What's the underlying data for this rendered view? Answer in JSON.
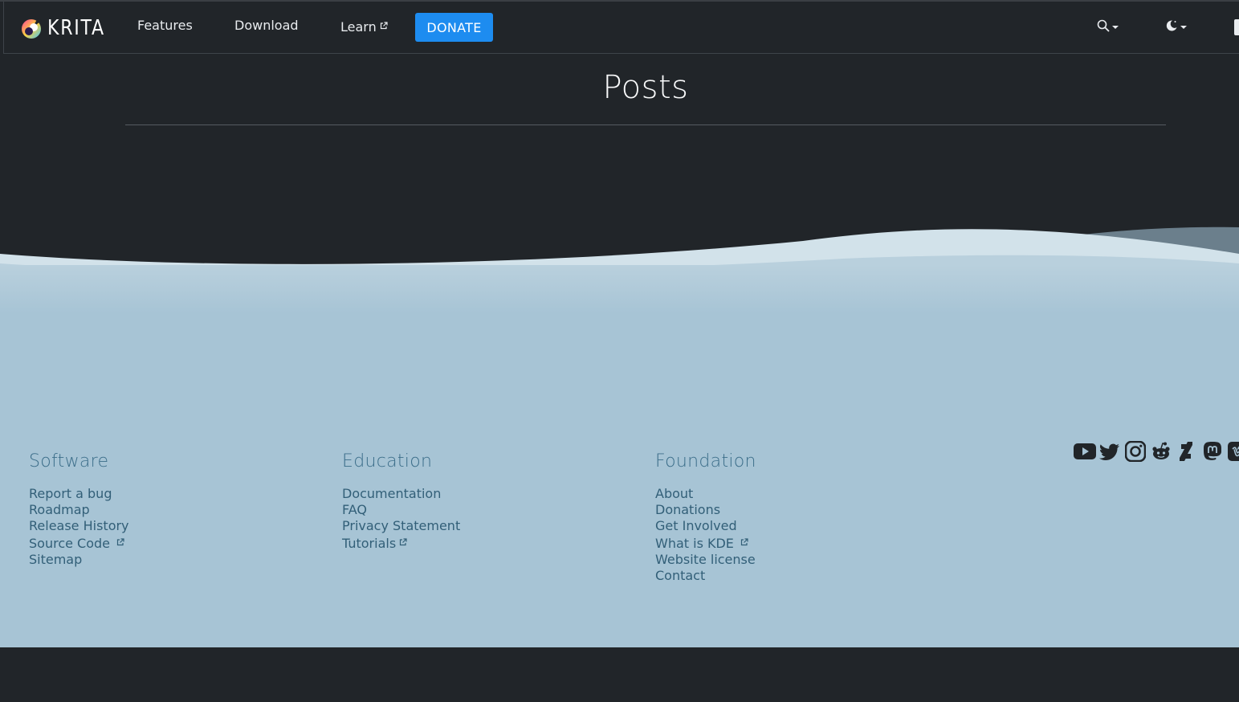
{
  "nav": {
    "brand": "KRITA",
    "links": {
      "features": "Features",
      "download": "Download",
      "learn": "Learn"
    },
    "donate": "DONATE",
    "icons": [
      "krita-logo-icon",
      "external-link-icon",
      "search-icon",
      "moon-icon",
      "chevron-down-icon"
    ]
  },
  "page": {
    "title": "Posts"
  },
  "footer": {
    "software": {
      "title": "Software",
      "items": [
        "Report a bug",
        "Roadmap",
        "Release History",
        "Source Code",
        "Sitemap"
      ]
    },
    "education": {
      "title": "Education",
      "items": [
        "Documentation",
        "FAQ",
        "Privacy Statement",
        "Tutorials"
      ]
    },
    "foundation": {
      "title": "Foundation",
      "items": [
        "About",
        "Donations",
        "Get Involved",
        "What is KDE",
        "Website license",
        "Contact"
      ]
    },
    "social_icons": [
      "youtube-icon",
      "twitter-icon",
      "instagram-icon",
      "reddit-icon",
      "deviantart-icon",
      "mastodon-icon",
      "vimeo-icon"
    ]
  },
  "colors": {
    "background": "#212529",
    "accent": "#1d8cf0",
    "footer_bg": "#a7c4d5",
    "footer_text": "#325f78"
  }
}
